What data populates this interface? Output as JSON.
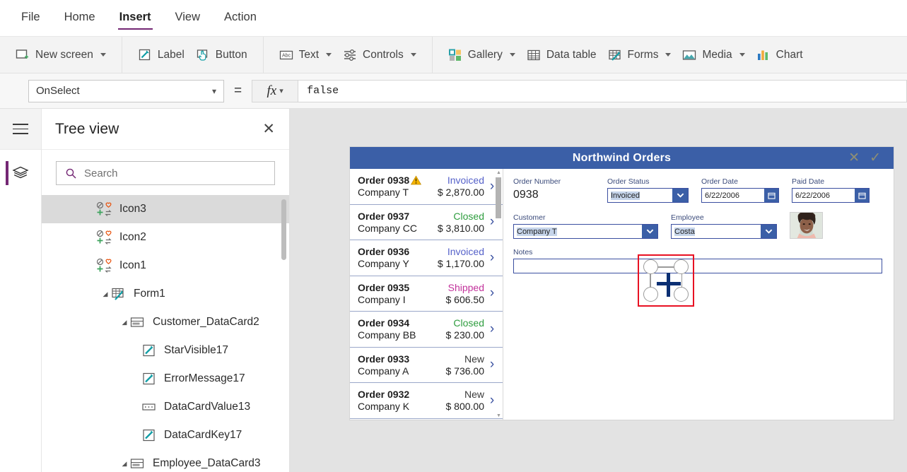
{
  "menu": {
    "items": [
      {
        "label": "File",
        "active": false
      },
      {
        "label": "Home",
        "active": false
      },
      {
        "label": "Insert",
        "active": true
      },
      {
        "label": "View",
        "active": false
      },
      {
        "label": "Action",
        "active": false
      }
    ]
  },
  "ribbon": {
    "groups": [
      {
        "buttons": [
          {
            "label": "New screen",
            "icon": "new-screen-icon",
            "caret": true
          }
        ]
      },
      {
        "buttons": [
          {
            "label": "Label",
            "icon": "label-icon",
            "caret": false
          },
          {
            "label": "Button",
            "icon": "button-icon",
            "caret": false
          }
        ]
      },
      {
        "buttons": [
          {
            "label": "Text",
            "icon": "text-icon",
            "caret": true
          },
          {
            "label": "Controls",
            "icon": "controls-icon",
            "caret": true
          }
        ]
      },
      {
        "buttons": [
          {
            "label": "Gallery",
            "icon": "gallery-icon",
            "caret": true
          },
          {
            "label": "Data table",
            "icon": "data-table-icon",
            "caret": false
          },
          {
            "label": "Forms",
            "icon": "forms-icon",
            "caret": true
          },
          {
            "label": "Media",
            "icon": "media-icon",
            "caret": true
          },
          {
            "label": "Chart",
            "icon": "chart-icon",
            "caret": false
          }
        ]
      }
    ]
  },
  "formula_bar": {
    "property": "OnSelect",
    "equals": "=",
    "fx_label": "fx",
    "value": "false"
  },
  "rail": {
    "hamburger": "hamburger-icon",
    "tree_view_icon": "layers-icon"
  },
  "tree_view": {
    "title": "Tree view",
    "close": "✕",
    "search": {
      "placeholder": "Search",
      "value": ""
    },
    "nodes": [
      {
        "label": "Icon3",
        "icon": "icon-control-icon",
        "indent": 0,
        "twist": "",
        "selected": true
      },
      {
        "label": "Icon2",
        "icon": "icon-control-icon",
        "indent": 0,
        "twist": "",
        "selected": false
      },
      {
        "label": "Icon1",
        "icon": "icon-control-icon",
        "indent": 0,
        "twist": "",
        "selected": false
      },
      {
        "label": "Form1",
        "icon": "form-icon",
        "indent": 1,
        "twist": "◢",
        "selected": false
      },
      {
        "label": "Customer_DataCard2",
        "icon": "datacard-icon",
        "indent": 2,
        "twist": "◢",
        "selected": false
      },
      {
        "label": "StarVisible17",
        "icon": "label-control-icon",
        "indent": 3,
        "twist": "",
        "selected": false
      },
      {
        "label": "ErrorMessage17",
        "icon": "label-control-icon",
        "indent": 3,
        "twist": "",
        "selected": false
      },
      {
        "label": "DataCardValue13",
        "icon": "dropdown-control-icon",
        "indent": 3,
        "twist": "",
        "selected": false
      },
      {
        "label": "DataCardKey17",
        "icon": "label-control-icon",
        "indent": 3,
        "twist": "",
        "selected": false
      },
      {
        "label": "Employee_DataCard3",
        "icon": "datacard-icon",
        "indent": 2,
        "twist": "◢",
        "selected": false
      }
    ]
  },
  "app": {
    "title": "Northwind Orders",
    "header_actions": [
      {
        "name": "cancel-icon",
        "glyph": "✕"
      },
      {
        "name": "check-icon",
        "glyph": "✓"
      }
    ],
    "gallery": [
      {
        "order": "Order 0938",
        "company": "Company T",
        "status": "Invoiced",
        "status_color": "#5561c9",
        "amount": "$ 2,870.00",
        "warning": true
      },
      {
        "order": "Order 0937",
        "company": "Company CC",
        "status": "Closed",
        "status_color": "#2e9d3e",
        "amount": "$ 3,810.00",
        "warning": false
      },
      {
        "order": "Order 0936",
        "company": "Company Y",
        "status": "Invoiced",
        "status_color": "#5561c9",
        "amount": "$ 1,170.00",
        "warning": false
      },
      {
        "order": "Order 0935",
        "company": "Company I",
        "status": "Shipped",
        "status_color": "#c2329b",
        "amount": "$ 606.50",
        "warning": false
      },
      {
        "order": "Order 0934",
        "company": "Company BB",
        "status": "Closed",
        "status_color": "#2e9d3e",
        "amount": "$ 230.00",
        "warning": false
      },
      {
        "order": "Order 0933",
        "company": "Company A",
        "status": "New",
        "status_color": "#3a3a3a",
        "amount": "$ 736.00",
        "warning": false
      },
      {
        "order": "Order 0932",
        "company": "Company K",
        "status": "New",
        "status_color": "#3a3a3a",
        "amount": "$ 800.00",
        "warning": false
      }
    ],
    "detail": {
      "order_number": {
        "label": "Order Number",
        "value": "0938"
      },
      "order_status": {
        "label": "Order Status",
        "value": "Invoiced"
      },
      "order_date": {
        "label": "Order Date",
        "value": "6/22/2006"
      },
      "paid_date": {
        "label": "Paid Date",
        "value": "6/22/2006"
      },
      "customer": {
        "label": "Customer",
        "value": "Company T"
      },
      "employee": {
        "label": "Employee",
        "value": "Costa"
      },
      "notes": {
        "label": "Notes",
        "value": ""
      }
    }
  },
  "colors": {
    "accent_purple": "#742774",
    "app_header_blue": "#3b5fa7",
    "selection_red": "#e81123",
    "move_cursor_blue": "#0b2f73"
  }
}
